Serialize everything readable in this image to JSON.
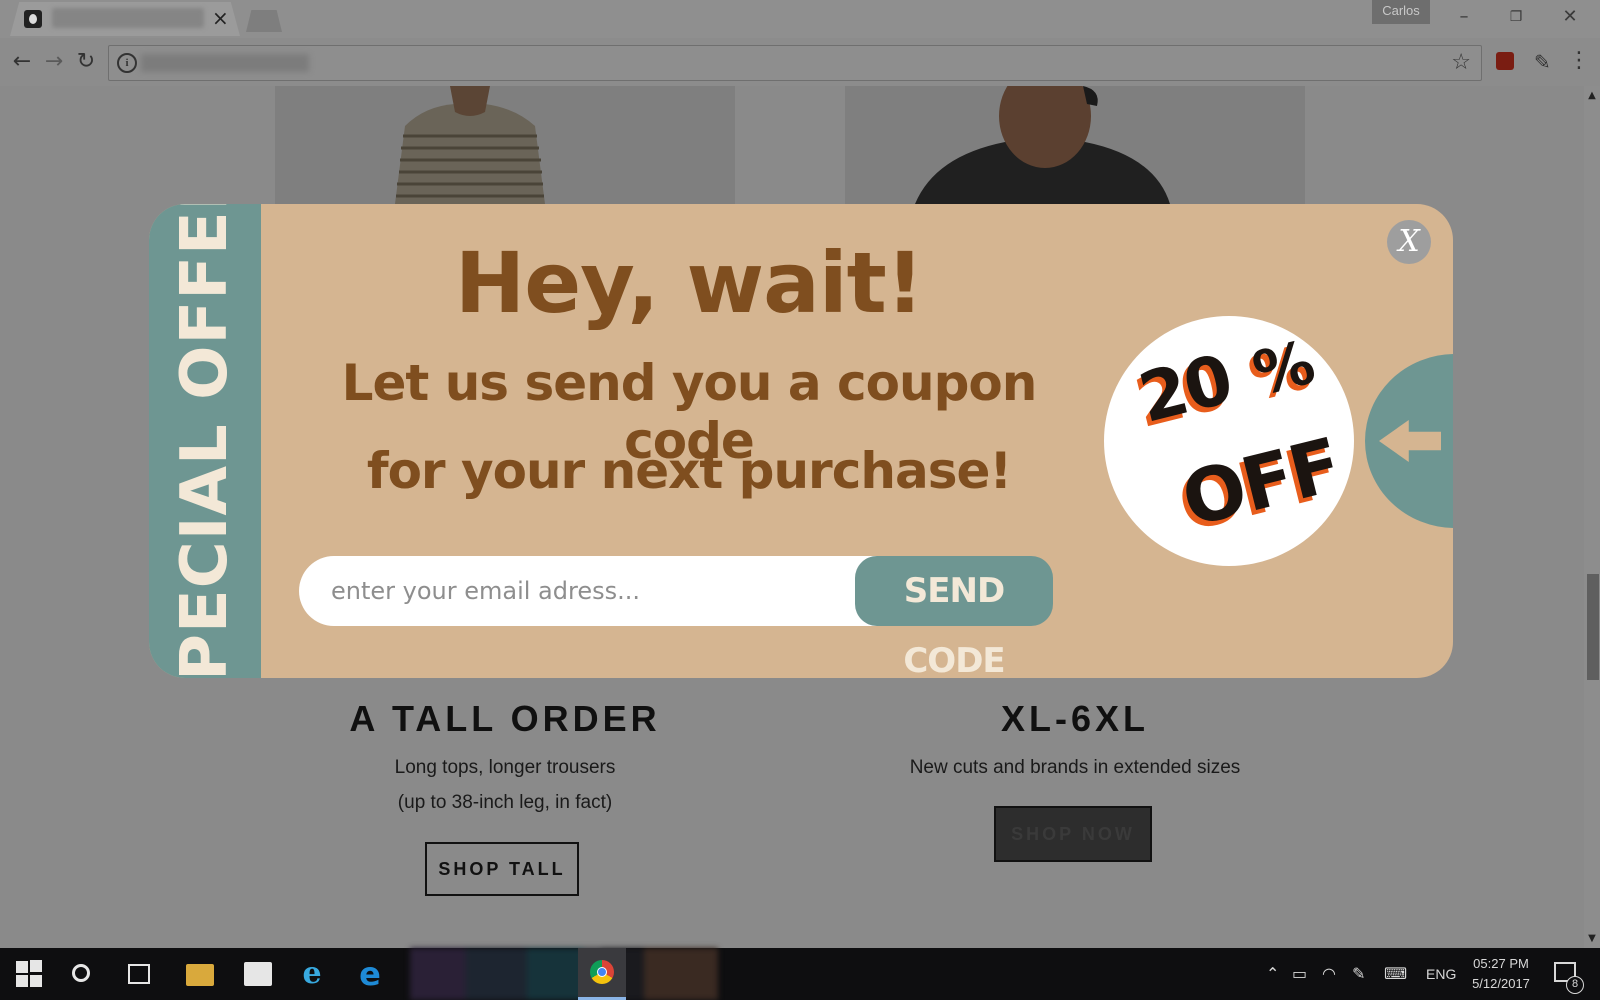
{
  "browser": {
    "tab_close": "×",
    "profile_name": "Carlos",
    "window_controls": {
      "minimize": "–",
      "restore": "❐",
      "close": "✕"
    },
    "nav": {
      "back": "←",
      "forward": "→",
      "reload": "↻"
    },
    "info_glyph": "i",
    "star_glyph": "☆",
    "menu_glyph": "⋮"
  },
  "page": {
    "cards": [
      {
        "title": "A TALL ORDER",
        "desc_line1": "Long tops, longer trousers",
        "desc_line2": "(up to 38-inch leg, in fact)",
        "button": "SHOP TALL"
      },
      {
        "title": "XL-6XL",
        "desc_line1": "New cuts and brands in extended sizes",
        "button": "SHOP NOW"
      }
    ]
  },
  "popup": {
    "side_label": "SPECIAL OFFER",
    "headline": "Hey, wait!",
    "subline1": "Let us send you a coupon code",
    "subline2": "for your next purchase!",
    "email_placeholder": "enter your email adress...",
    "email_value": "",
    "send_button": "SEND CODE",
    "badge": {
      "number": "20",
      "percent": "%",
      "off": "OFF"
    },
    "close_label": "X",
    "colors": {
      "panel": "#d5b591",
      "accent": "#6e9692",
      "headline": "#7f4e1f",
      "badge_shadow": "#e85d1c"
    }
  },
  "taskbar": {
    "language": "ENG",
    "time": "05:27 PM",
    "date": "5/12/2017",
    "notification_count": "8",
    "icons": [
      "windows-start-icon",
      "cortana-icon",
      "task-view-icon",
      "file-explorer-icon",
      "store-icon",
      "internet-explorer-icon",
      "edge-icon",
      "chrome-icon"
    ]
  }
}
